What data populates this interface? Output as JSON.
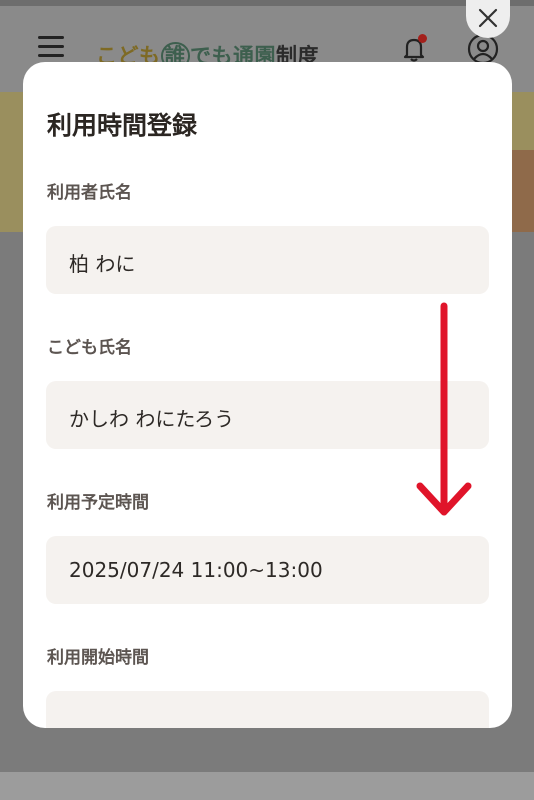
{
  "header": {
    "logo_part1": "こども",
    "logo_part2": "誰",
    "logo_part3": "でも通園",
    "logo_part4": "制度",
    "menu_icon": "hamburger-icon",
    "notification_icon": "bell-icon",
    "account_icon": "user-icon"
  },
  "modal": {
    "title": "利用時間登録",
    "close_icon": "close-icon",
    "fields": [
      {
        "label": "利用者氏名",
        "value": "柏 わに"
      },
      {
        "label": "こども氏名",
        "value": "かしわ わにたろう"
      },
      {
        "label": "利用予定時間",
        "value": "2025/07/24 11:00~13:00"
      },
      {
        "label": "利用開始時間",
        "value": ""
      }
    ]
  },
  "colors": {
    "overlay": "#7f7f7f",
    "modal_bg": "#ffffff",
    "field_bg": "#f5f2ef",
    "arrow": "#e0142a",
    "notification_dot": "#a3201b"
  }
}
